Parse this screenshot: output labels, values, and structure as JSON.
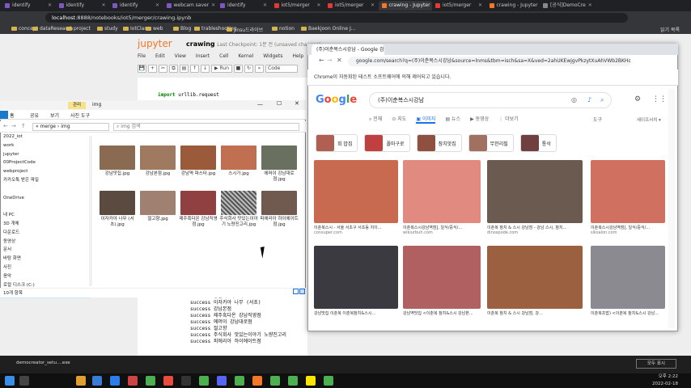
{
  "chrome": {
    "tabs": [
      {
        "label": "identify",
        "color": "#7e57c2"
      },
      {
        "label": "identify",
        "color": "#7e57c2"
      },
      {
        "label": "identify",
        "color": "#7e57c2"
      },
      {
        "label": "webcam saver",
        "color": "#7e57c2"
      },
      {
        "label": "identify",
        "color": "#7e57c2"
      },
      {
        "label": "iot5/merger",
        "color": "#e53935"
      },
      {
        "label": "iot5/merger",
        "color": "#e53935"
      },
      {
        "label": "crawing - Jupyter",
        "color": "#f37726"
      },
      {
        "label": "iot5/merger",
        "color": "#e53935"
      },
      {
        "label": "crawing - Jupyter",
        "color": "#f37726"
      },
      {
        "label": "[공식]DemoCre",
        "color": "#888888"
      }
    ],
    "url_host": "localhost",
    "url_rest": ":8888/notebooks/iot5/merger/crawing.ipynb",
    "bookmarks": [
      "concept",
      "dataResearch",
      "project",
      "study",
      "IotClass",
      "web",
      "Blog",
      "trableshooting",
      "jinsu드라이브",
      "notion",
      "Baekjoon Online J..."
    ],
    "bookmarks_right": "읽기 목록"
  },
  "jupyter": {
    "logo": "jupyter",
    "title": "crawing",
    "checkpoint": "Last Checkpoint: 1분 전  (unsaved changes)",
    "menu": [
      "File",
      "Edit",
      "View",
      "Insert",
      "Cell",
      "Kernel",
      "Widgets",
      "Help"
    ],
    "run_label": "Run",
    "cell_type": "Code",
    "code_keyword": "import",
    "code_rest": " urllib.request",
    "output_lines": [
      "success  강남맛집",
      "success  강남역 파스타",
      "success  이자카야 나무  (서초)",
      "success  강남본점",
      "success  제주흑다온 강남직영점",
      "success  에머이 강남대로점",
      "success  절고향",
      "success  주식회사 맛있는이야기 노량진고리",
      "success  피에리아 하이에이트점"
    ]
  },
  "explorer": {
    "title": "img",
    "manage_tab": "관리",
    "ribbon": [
      "홈",
      "공유",
      "보기",
      "사진 도구"
    ],
    "path": [
      "merge",
      "img"
    ],
    "search_placeholder": "img 검색",
    "nav_items": [
      "2022_iot",
      "work",
      "jupyter",
      "00ProjectCode",
      "webproject",
      "카카오톡 받은 파일",
      "",
      "OneDrive",
      "",
      "내 PC",
      "3D 개체",
      "다운로드",
      "동영상",
      "문서",
      "바탕 화면",
      "사진",
      "음악",
      "로컬 디스크 (C:)",
      "DATA (D:)"
    ],
    "files": [
      {
        "name": "강남맛집",
        "ext": ".jpg",
        "color": "#8a6a50"
      },
      {
        "name": "강남본점",
        "ext": ".jpg",
        "color": "#a07a60"
      },
      {
        "name": "강남역 파스타",
        "ext": ".jpg",
        "color": "#9b5a3a"
      },
      {
        "name": "스시가",
        "ext": ".jpg",
        "color": "#c07050"
      },
      {
        "name": "에머이 강남대로점",
        "ext": ".jpg",
        "color": "#6a7060"
      },
      {
        "name": "이자카야 나무 (서초)",
        "ext": ".jpg",
        "color": "#5a4a40"
      },
      {
        "name": "절고향",
        "ext": ".jpg",
        "color": "#a08070"
      },
      {
        "name": "제주흑다온 강남직영점",
        "ext": ".jpg",
        "color": "#904040"
      },
      {
        "name": "주식회사 맛있는이야기 노량진고리",
        "ext": ".jpg",
        "color": "#777777"
      },
      {
        "name": "피에리아 하이에이트점",
        "ext": ".jpg",
        "color": "#705a50"
      }
    ],
    "status": "10개 항목"
  },
  "popup": {
    "tab": "(주)이춘복스시강남 - Google 검색",
    "url": "google.com/search?q=(주)이춘복스시강남&source=lnms&tbm=isch&sa=X&ved=2ahUKEwjgvPkzytXuAhVWb2BKHc...",
    "info_bar": "Chrome이 자동화된 테스트 소프트웨어에 의해 제어되고 있습니다.",
    "logo_letters": [
      {
        "ch": "G",
        "color": "#4285f4"
      },
      {
        "ch": "o",
        "color": "#ea4335"
      },
      {
        "ch": "o",
        "color": "#fbbc05"
      },
      {
        "ch": "g",
        "color": "#4285f4"
      },
      {
        "ch": "l",
        "color": "#34a853"
      },
      {
        "ch": "e",
        "color": "#ea4335"
      }
    ],
    "query": "(주)이춘복스시강남",
    "tabs": [
      "전체",
      "지도",
      "이미지",
      "뉴스",
      "동영상",
      "더보기"
    ],
    "selected_tab": "이미지",
    "tools": "도구",
    "safe_search": "세이프서치 ▾",
    "chips": [
      {
        "label": "회 밥집",
        "color": "#b06050"
      },
      {
        "label": "폴마구로",
        "color": "#c04040"
      },
      {
        "label": "참치맛집",
        "color": "#905040"
      },
      {
        "label": "무한리필",
        "color": "#a07060"
      },
      {
        "label": "통삭",
        "color": "#704040"
      }
    ],
    "results": [
      {
        "cap": "이춘복스시 - 서울 서초구 서초동 치이...",
        "src": "consuper.com",
        "color": "#c86a50"
      },
      {
        "cap": "이춘복스시강남역점], 일식/중식/...",
        "src": "wikiurbuh.com",
        "color": "#e08a80"
      },
      {
        "cap": "이춘복 참치 & 스시 강남점 - 강남 스시, 참치...",
        "src": "dinospode.com",
        "color": "#6a5a50"
      },
      {
        "cap": "이춘복스시강남역점], 일식/중식/...",
        "src": "siksalon.com",
        "color": "#d07060"
      },
      {
        "cap": "강남맛집 이춘복 이춘복참치&스시...",
        "src": "",
        "color": "#3a3a40"
      },
      {
        "cap": "강남역맛집 <이춘복 참치&스시 강남본...",
        "src": "",
        "color": "#b06060"
      },
      {
        "cap": "이춘복 참치 & 스시 강남점, 강...",
        "src": "",
        "color": "#9a6040"
      },
      {
        "cap": "이춘복초밥) <이춘복 참치&스시 강남...",
        "src": "",
        "color": "#8a8a90"
      }
    ]
  },
  "notification": {
    "text": "democreator_setu....exe",
    "button": "모두 표시"
  },
  "taskbar": {
    "time": "오후 2:22",
    "date": "2022-02-18"
  }
}
